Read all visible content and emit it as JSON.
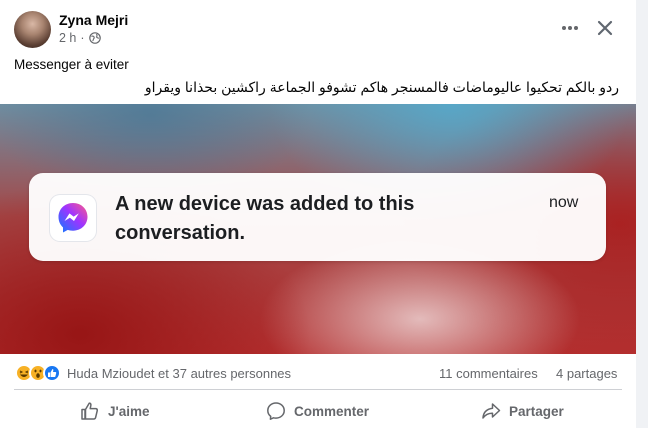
{
  "post": {
    "author": "Zyna Mejri",
    "time": "2 h",
    "privacy_icon": "globe-icon",
    "caption_line1": "Messenger à eviter",
    "caption_line2": "ردو بالكم تحكيوا عاليوماضات فالمسنجر هاكم تشوفو الجماعة راكشين بحذانا ويقراو"
  },
  "image": {
    "notification": {
      "app_icon": "messenger-icon",
      "text": "A new device was added to this conversation.",
      "time": "now"
    }
  },
  "stats": {
    "reaction_icons": [
      "haha-icon",
      "wow-icon",
      "like-icon"
    ],
    "reactors": "Huda Mzioudet et 37 autres personnes",
    "comments": "11 commentaires",
    "shares": "4 partages"
  },
  "actions": {
    "like_label": "J'aime",
    "comment_label": "Commenter",
    "share_label": "Partager"
  },
  "colors": {
    "secondary_text": "#65676b",
    "like_blue": "#1877f2",
    "reaction_yellow": "#f7b125"
  }
}
